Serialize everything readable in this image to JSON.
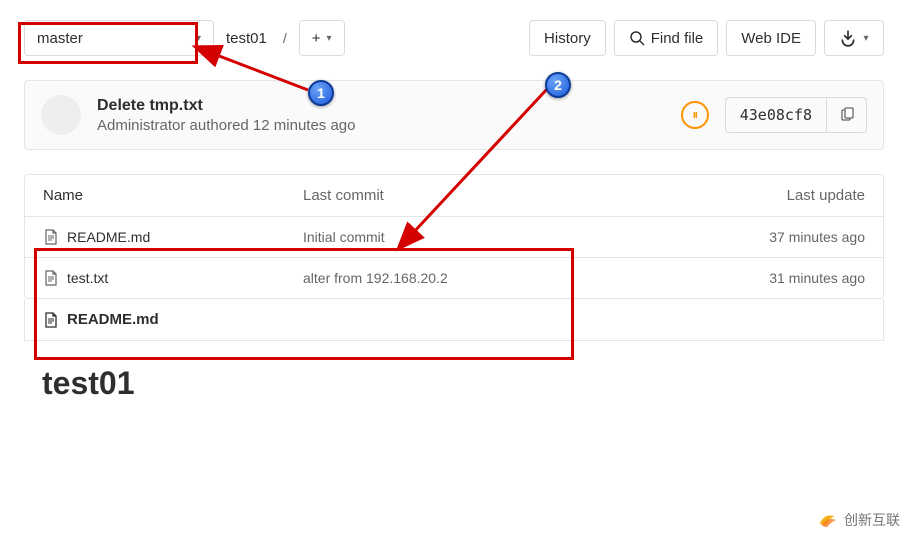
{
  "topbar": {
    "branch": "master",
    "breadcrumb": "test01",
    "history_label": "History",
    "find_file_label": "Find file",
    "web_ide_label": "Web IDE"
  },
  "commit": {
    "title": "Delete tmp.txt",
    "author": "Administrator",
    "authored_word": "authored",
    "time": "12 minutes ago",
    "sha": "43e08cf8"
  },
  "table": {
    "header_name": "Name",
    "header_commit": "Last commit",
    "header_update": "Last update",
    "rows": [
      {
        "name": "README.md",
        "commit": "Initial commit",
        "update": "37 minutes ago"
      },
      {
        "name": "test.txt",
        "commit": "alter from 192.168.20.2",
        "update": "31 minutes ago"
      }
    ]
  },
  "readme": {
    "file_label": "README.md",
    "title": "test01"
  },
  "annotations": {
    "marker1": "1",
    "marker2": "2"
  },
  "watermark": "创新互联"
}
